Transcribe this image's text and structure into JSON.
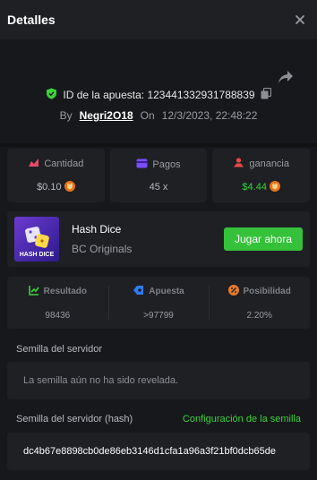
{
  "header": {
    "title": "Detalles"
  },
  "bet": {
    "id_label": "ID de la apuesta: 123441332931788839",
    "by_label": "By",
    "username": "Negri2O18",
    "on_label": "On",
    "datetime": "12/3/2023, 22:48:22"
  },
  "stats": {
    "amount": {
      "label": "Cantidad",
      "value": "$0.10"
    },
    "payout": {
      "label": "Pagos",
      "value": "45 x"
    },
    "profit": {
      "label": "ganancia",
      "value": "$4.44"
    }
  },
  "game": {
    "name": "Hash Dice",
    "provider": "BC Originals",
    "thumb_text": "HASH DICE",
    "play_label": "Jugar ahora"
  },
  "result": {
    "result": {
      "label": "Resultado",
      "value": "98436"
    },
    "bet": {
      "label": "Apuesta",
      "value": ">97799"
    },
    "chance": {
      "label": "Posibilidad",
      "value": "2.20%"
    }
  },
  "seed": {
    "server_label": "Semilla del servidor",
    "server_value": "La semilla aún no ha sido revelada.",
    "hash_label": "Semilla del servidor (hash)",
    "config_label": "Configuración de la semilla",
    "hash_value": "dc4b67e8898cb0de86eb3146d1cfa1a96a3f21bf0dcb65de"
  },
  "colors": {
    "accent_green": "#3bd13b",
    "play_button": "#35c13a",
    "coin": "#e8731a",
    "amount_icon": "#e84a6a",
    "payout_icon": "#7b4dff",
    "profit_icon": "#e84a4a",
    "bet_icon": "#2f7bff",
    "chance_icon": "#e87a2a"
  },
  "icons": {
    "shield": "shield-check-icon",
    "copy": "copy-icon",
    "share": "share-icon",
    "close": "close-icon",
    "coin": "shib-coin-icon"
  }
}
